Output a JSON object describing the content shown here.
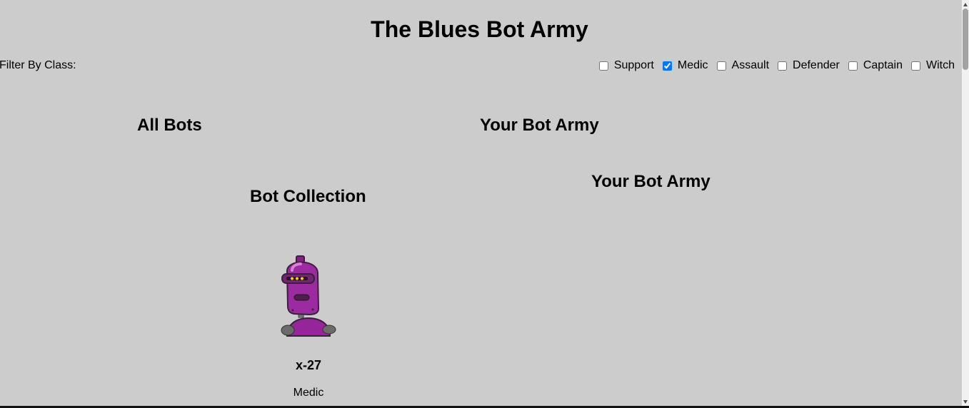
{
  "app": {
    "title": "The Blues Bot Army"
  },
  "filters": {
    "label": "Filter By Class:",
    "options": [
      {
        "label": "Support",
        "checked": false
      },
      {
        "label": "Medic",
        "checked": true
      },
      {
        "label": "Assault",
        "checked": false
      },
      {
        "label": "Defender",
        "checked": false
      },
      {
        "label": "Captain",
        "checked": false
      },
      {
        "label": "Witch",
        "checked": false
      }
    ]
  },
  "sections": {
    "all_bots": "All Bots",
    "your_army": "Your Bot Army",
    "your_army_subheading": "Your Bot Army",
    "collection": "Bot Collection"
  },
  "bots": [
    {
      "name": "x-27",
      "class": "Medic",
      "avatar_icon": "robot-avatar-icon",
      "color": "#8e2a8e"
    }
  ]
}
